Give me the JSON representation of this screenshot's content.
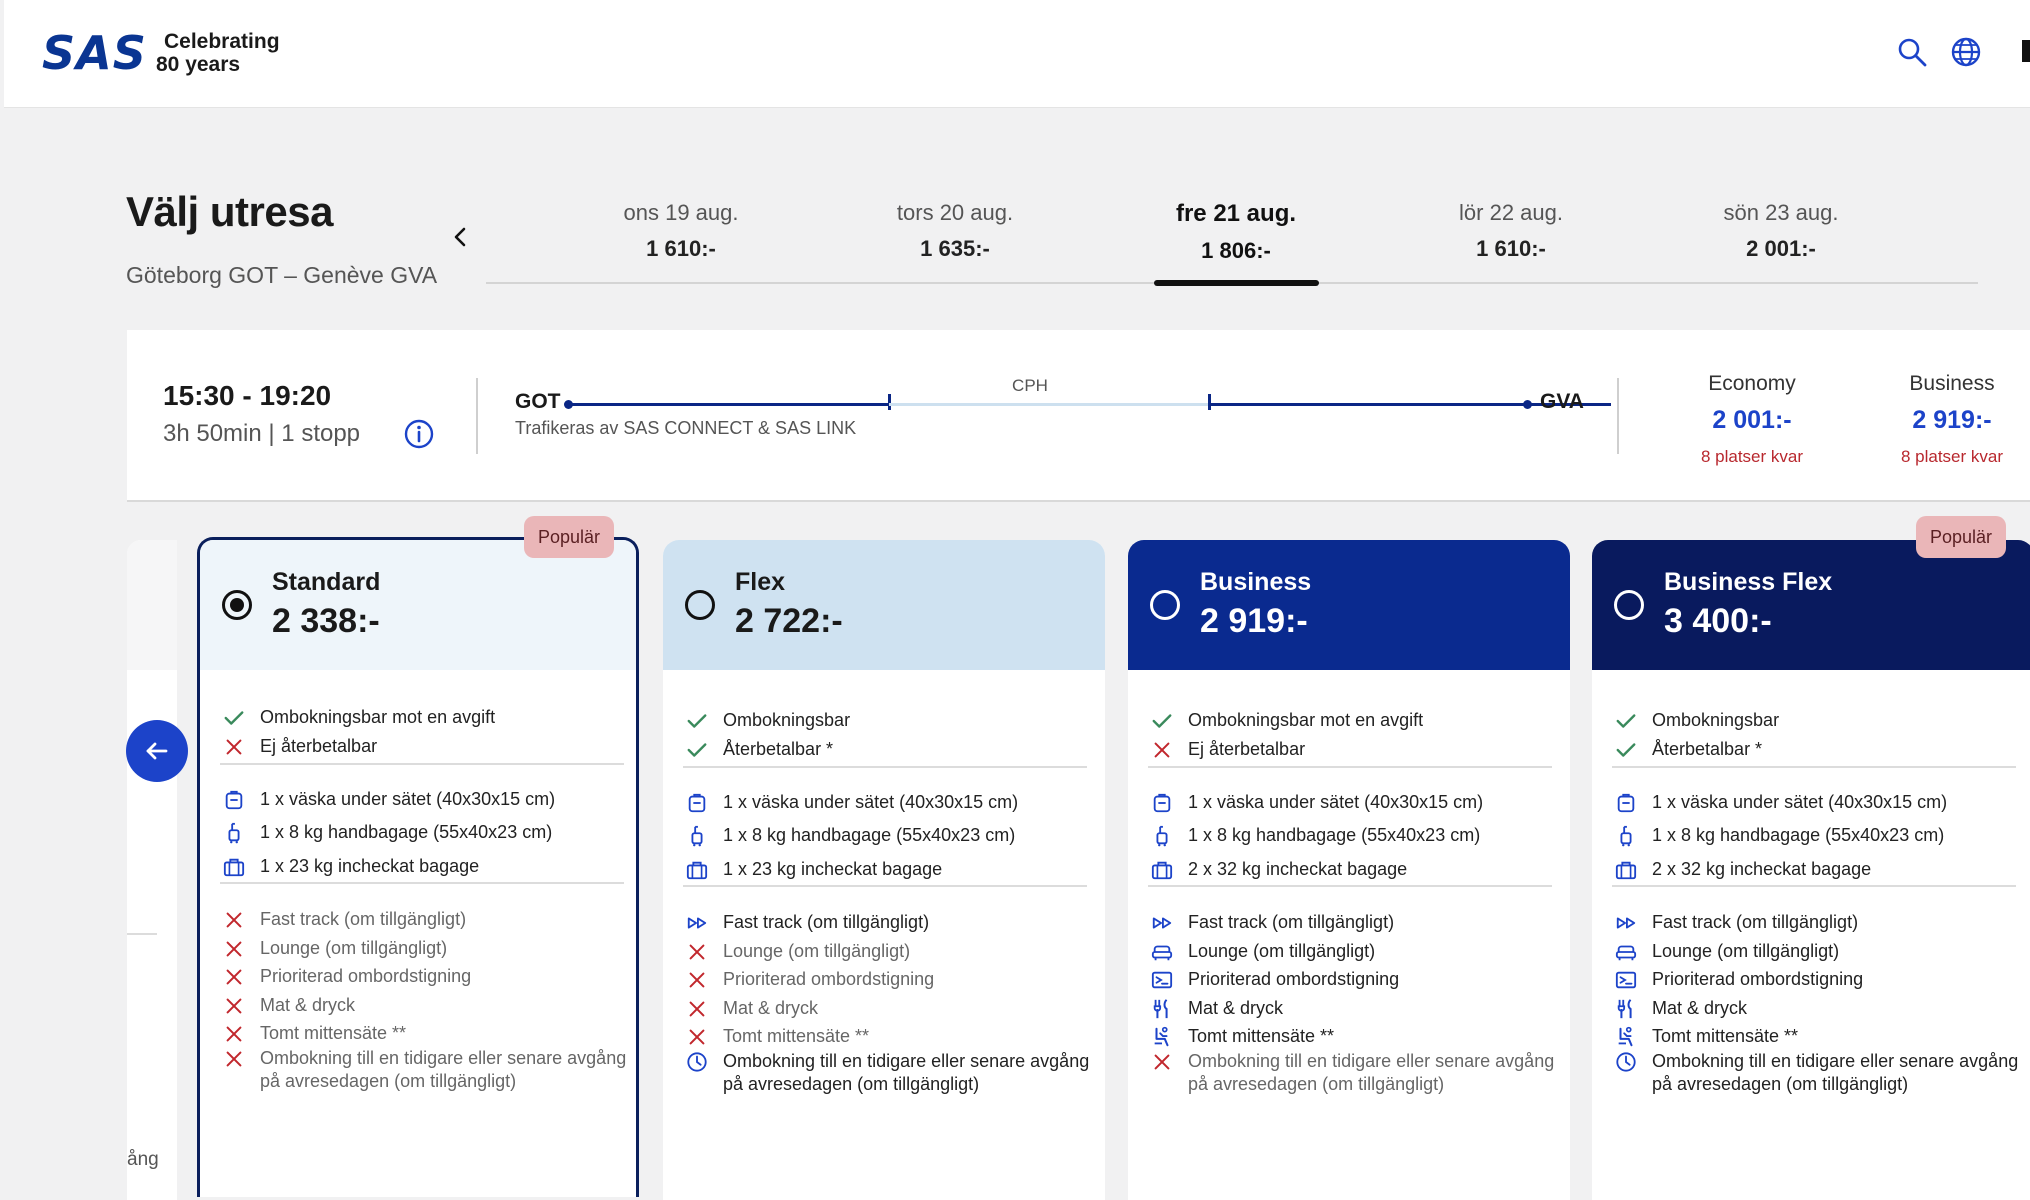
{
  "header": {
    "logo": "SAS",
    "tagline_1": "Celebrating",
    "tagline_2": "80 years"
  },
  "page": {
    "title": "Välj utresa",
    "route": "Göteborg GOT – Genève GVA"
  },
  "dates": [
    {
      "day": "ons 19 aug.",
      "price": "1 610:-"
    },
    {
      "day": "tors 20 aug.",
      "price": "1 635:-"
    },
    {
      "day": "fre 21 aug.",
      "price": "1 806:-"
    },
    {
      "day": "lör 22 aug.",
      "price": "1 610:-"
    },
    {
      "day": "sön 23 aug.",
      "price": "2 001:-"
    }
  ],
  "flight": {
    "times": "15:30 - 19:20",
    "duration": "3h 50min | 1 stopp",
    "from": "GOT",
    "via": "CPH",
    "to": "GVA",
    "operated_by": "Trafikeras av SAS CONNECT & SAS LINK",
    "cabins": [
      {
        "name": "Economy",
        "price": "2 001:-",
        "seats": "8 platser kvar"
      },
      {
        "name": "Business",
        "price": "2 919:-",
        "seats": "8 platser kvar"
      }
    ]
  },
  "peek_text": "ång",
  "fares": [
    {
      "name": "Standard",
      "price": "2 338:-",
      "badge": "Populär",
      "features": [
        {
          "icon": "check",
          "text": "Ombokningsbar mot en avgift",
          "off": false
        },
        {
          "icon": "cross",
          "text": "Ej återbetalbar",
          "off": false
        },
        {
          "icon": "bag-under-seat",
          "text": "1 x väska under sätet (40x30x15 cm)",
          "off": false
        },
        {
          "icon": "trolley",
          "text": "1 x 8 kg handbagage (55x40x23 cm)",
          "off": false
        },
        {
          "icon": "suitcase",
          "text": "1 x 23 kg incheckat bagage",
          "off": false
        },
        {
          "icon": "cross",
          "text": "Fast track (om tillgängligt)",
          "off": true
        },
        {
          "icon": "cross",
          "text": "Lounge (om tillgängligt)",
          "off": true
        },
        {
          "icon": "cross",
          "text": "Prioriterad ombordstigning",
          "off": true
        },
        {
          "icon": "cross",
          "text": "Mat & dryck",
          "off": true
        },
        {
          "icon": "cross",
          "text": "Tomt mittensäte **",
          "off": true
        },
        {
          "icon": "cross",
          "text": "Ombokning till en tidigare eller senare avgång på avresedagen (om tillgängligt)",
          "off": true
        }
      ]
    },
    {
      "name": "Flex",
      "price": "2 722:-",
      "badge": "",
      "features": [
        {
          "icon": "check",
          "text": "Ombokningsbar",
          "off": false
        },
        {
          "icon": "check",
          "text": "Återbetalbar *",
          "off": false
        },
        {
          "icon": "bag-under-seat",
          "text": "1 x väska under sätet (40x30x15 cm)",
          "off": false
        },
        {
          "icon": "trolley",
          "text": "1 x 8 kg handbagage (55x40x23 cm)",
          "off": false
        },
        {
          "icon": "suitcase",
          "text": "1 x 23 kg incheckat bagage",
          "off": false
        },
        {
          "icon": "fast-track",
          "text": "Fast track (om tillgängligt)",
          "off": false
        },
        {
          "icon": "cross",
          "text": "Lounge (om tillgängligt)",
          "off": true
        },
        {
          "icon": "cross",
          "text": "Prioriterad ombordstigning",
          "off": true
        },
        {
          "icon": "cross",
          "text": "Mat & dryck",
          "off": true
        },
        {
          "icon": "cross",
          "text": "Tomt mittensäte **",
          "off": true
        },
        {
          "icon": "clock",
          "text": "Ombokning till en tidigare eller senare avgång på avresedagen (om tillgängligt)",
          "off": false
        }
      ]
    },
    {
      "name": "Business",
      "price": "2 919:-",
      "badge": "",
      "features": [
        {
          "icon": "check",
          "text": "Ombokningsbar mot en avgift",
          "off": false
        },
        {
          "icon": "cross",
          "text": "Ej återbetalbar",
          "off": false
        },
        {
          "icon": "bag-under-seat",
          "text": "1 x väska under sätet (40x30x15 cm)",
          "off": false
        },
        {
          "icon": "trolley",
          "text": "1 x 8 kg handbagage (55x40x23 cm)",
          "off": false
        },
        {
          "icon": "suitcase",
          "text": "2 x 32 kg incheckat bagage",
          "off": false
        },
        {
          "icon": "fast-track",
          "text": "Fast track (om tillgängligt)",
          "off": false
        },
        {
          "icon": "lounge",
          "text": "Lounge (om tillgängligt)",
          "off": false
        },
        {
          "icon": "boarding",
          "text": "Prioriterad ombordstigning",
          "off": false
        },
        {
          "icon": "cutlery",
          "text": "Mat & dryck",
          "off": false
        },
        {
          "icon": "seat",
          "text": "Tomt mittensäte **",
          "off": false
        },
        {
          "icon": "cross",
          "text": "Ombokning till en tidigare eller senare avgång på avresedagen (om tillgängligt)",
          "off": true
        }
      ]
    },
    {
      "name": "Business Flex",
      "price": "3 400:-",
      "badge": "Populär",
      "features": [
        {
          "icon": "check",
          "text": "Ombokningsbar",
          "off": false
        },
        {
          "icon": "check",
          "text": "Återbetalbar *",
          "off": false
        },
        {
          "icon": "bag-under-seat",
          "text": "1 x väska under sätet (40x30x15 cm)",
          "off": false
        },
        {
          "icon": "trolley",
          "text": "1 x 8 kg handbagage (55x40x23 cm)",
          "off": false
        },
        {
          "icon": "suitcase",
          "text": "2 x 32 kg incheckat bagage",
          "off": false
        },
        {
          "icon": "fast-track",
          "text": "Fast track (om tillgängligt)",
          "off": false
        },
        {
          "icon": "lounge",
          "text": "Lounge (om tillgängligt)",
          "off": false
        },
        {
          "icon": "boarding",
          "text": "Prioriterad ombordstigning",
          "off": false
        },
        {
          "icon": "cutlery",
          "text": "Mat & dryck",
          "off": false
        },
        {
          "icon": "seat",
          "text": "Tomt mittensäte **",
          "off": false
        },
        {
          "icon": "clock",
          "text": "Ombokning till en tidigare eller senare avgång på avresedagen (om tillgängligt)",
          "off": false
        }
      ]
    }
  ],
  "colors": {
    "brand_blue": "#0a3592",
    "price_blue": "#1c43c9",
    "business_navy": "#0a2a8f",
    "business_flex_navy": "#091a5e",
    "flex_light": "#cfe2f1",
    "standard_light": "#eef5fa",
    "check_green": "#3a8a5c",
    "cross_red": "#c1272d",
    "seats_red": "#b8282e",
    "badge_pink": "#eab6b8"
  }
}
